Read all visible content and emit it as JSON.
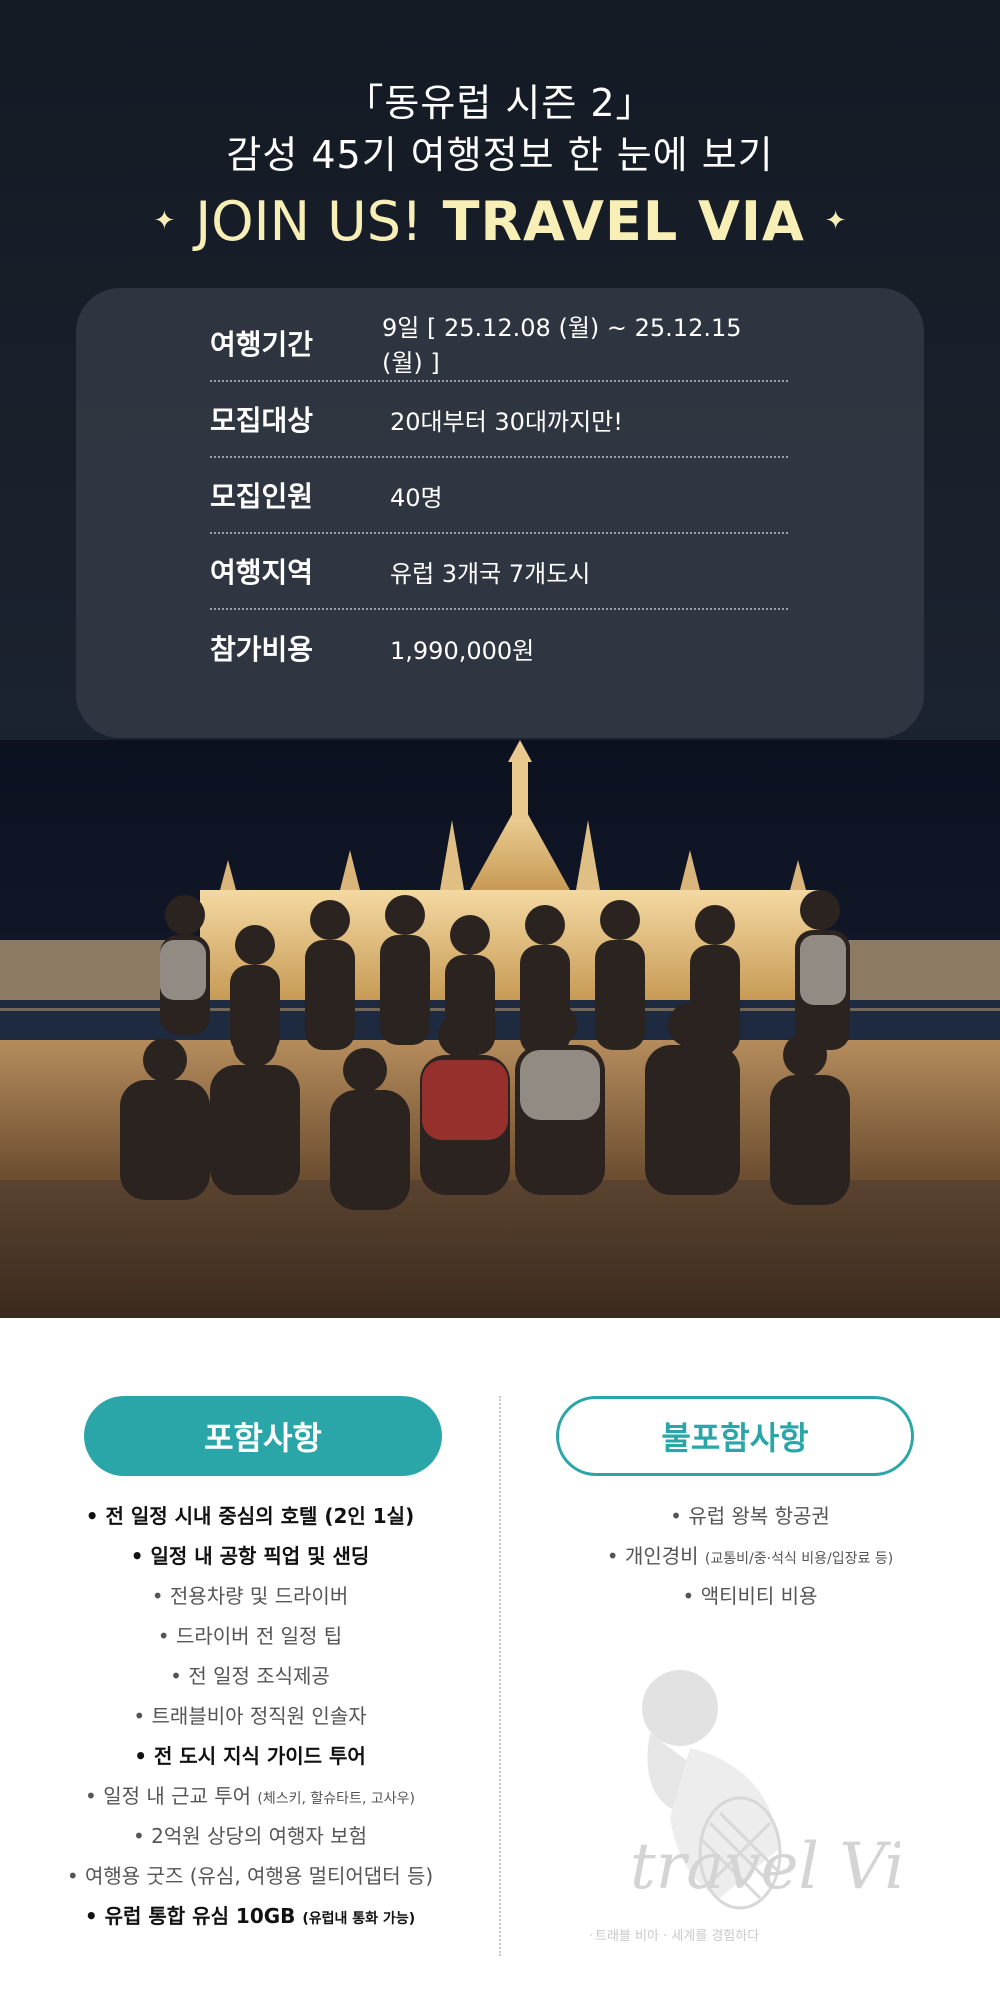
{
  "header": {
    "line1": "「동유럽 시즌 2」",
    "line2": "감성 45기 여행정보 한 눈에 보기",
    "join_light": "JOIN US!",
    "join_bold": "TRAVEL VIA",
    "spark_glyph": "✦"
  },
  "info": [
    {
      "label": "여행기간",
      "value": "9일 [ 25.12.08 (월) ~ 25.12.15 (월) ]"
    },
    {
      "label": "모집대상",
      "value": "20대부터 30대까지만!"
    },
    {
      "label": "모집인원",
      "value": "40명"
    },
    {
      "label": "여행지역",
      "value": "유럽 3개국 7개도시"
    },
    {
      "label": "참가비용",
      "value": "1,990,000원"
    }
  ],
  "included": {
    "title": "포함사항",
    "items": [
      {
        "text": "전 일정 시내 중심의 호텔 (2인 1실)",
        "note": "",
        "bold": true
      },
      {
        "text": "일정 내 공항 픽업 및 샌딩",
        "note": "",
        "bold": true
      },
      {
        "text": "전용차량 및 드라이버",
        "note": "",
        "bold": false
      },
      {
        "text": "드라이버 전 일정 팁",
        "note": "",
        "bold": false
      },
      {
        "text": "전 일정 조식제공",
        "note": "",
        "bold": false
      },
      {
        "text": "트래블비아 정직원 인솔자",
        "note": "",
        "bold": false
      },
      {
        "text": "전 도시 지식 가이드 투어",
        "note": "",
        "bold": true
      },
      {
        "text": "일정 내 근교 투어 ",
        "note": "(체스키, 할슈타트, 고사우)",
        "bold": false
      },
      {
        "text": "2억원 상당의 여행자 보험",
        "note": "",
        "bold": false
      },
      {
        "text": "여행용 굿즈 (유심, 여행용 멀티어댑터 등)",
        "note": "",
        "bold": false
      },
      {
        "text": "유럽 통합 유심 10GB ",
        "note": "(유럽내 통화 가능)",
        "bold": true
      }
    ]
  },
  "excluded": {
    "title": "불포함사항",
    "items": [
      {
        "text": "유럽 왕복 항공권",
        "note": "",
        "bold": false
      },
      {
        "text": "개인경비 ",
        "note": "(교통비/중·석식 비용/입장료 등)",
        "bold": false
      },
      {
        "text": "액티비티 비용",
        "note": "",
        "bold": false
      }
    ]
  },
  "logo": {
    "wordmark": "travel Via",
    "tagline": "트래블 비아 · 세계를 경험하다"
  },
  "colors": {
    "accent": "#2aa6a9",
    "title_yellow": "#f7efb6",
    "dark_bg": "#161c27"
  }
}
